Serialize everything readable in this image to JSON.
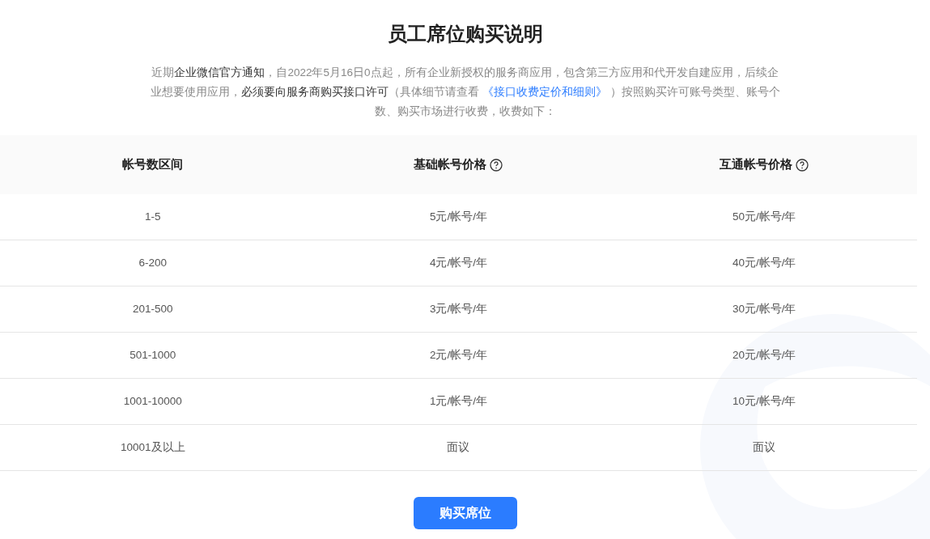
{
  "title": "员工席位购买说明",
  "intro": {
    "before": "近期**企业微信官方通知**，自2022年5月16日0点起，所有企业新授权的服务商应用，包含第三方应用和代开发自建应用，后续企业想要使用应用，**必须要向服务商购买接口许可**（具体细节请查看",
    "link": "《接口收费定价和细则》",
    "after": "）按照购买许可账号类型、账号个数、购买市场进行收费，收费如下："
  },
  "table": {
    "columns": [
      {
        "label": "帐号数区间",
        "kind": "plain"
      },
      {
        "label": "基础帐号价格",
        "kind": "with_help"
      },
      {
        "label": "互通帐号价格",
        "kind": "with_help"
      }
    ],
    "rows": [
      [
        "1-5",
        "5元/帐号/年",
        "50元/帐号/年"
      ],
      [
        "6-200",
        "4元/帐号/年",
        "40元/帐号/年"
      ],
      [
        "201-500",
        "3元/帐号/年",
        "30元/帐号/年"
      ],
      [
        "501-1000",
        "2元/帐号/年",
        "20元/帐号/年"
      ],
      [
        "1001-10000",
        "1元/帐号/年",
        "10元/帐号/年"
      ],
      [
        "10001及以上",
        "面议",
        "面议"
      ]
    ]
  },
  "button": "购买席位"
}
